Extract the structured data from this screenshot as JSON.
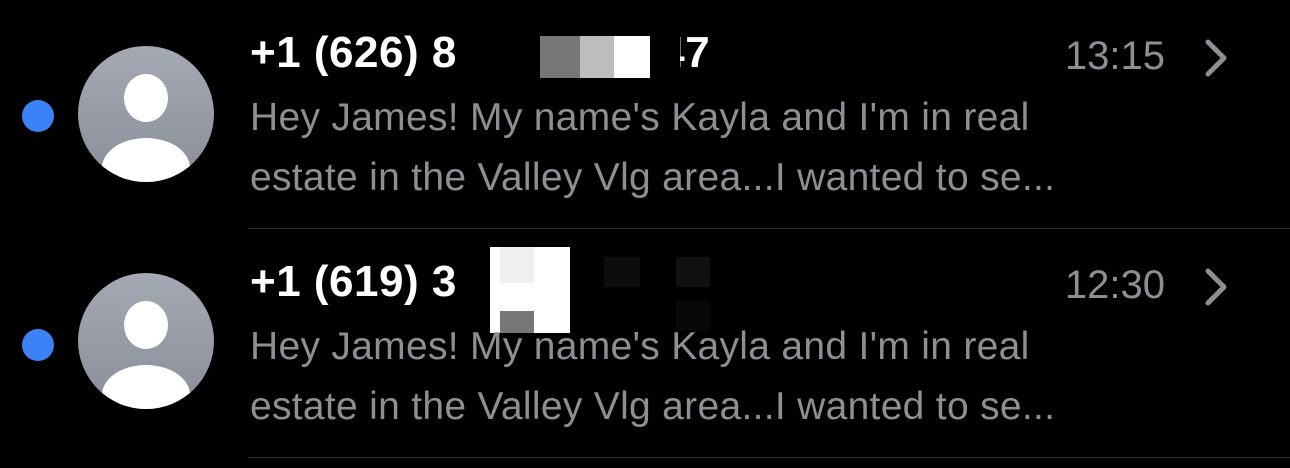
{
  "colors": {
    "background": "#000000",
    "unread_dot": "#3b82f6",
    "sender_text": "#ffffff",
    "secondary_text": "#8e8e93",
    "separator": "#2c2c2e"
  },
  "conversations": [
    {
      "sender_prefix": "+1 (626) 8",
      "sender_suffix": "47",
      "time": "13:15",
      "unread": true,
      "avatar_icon": "person-placeholder-icon",
      "chevron_icon": "chevron-right-icon",
      "preview_line_1": "Hey James! My name's Kayla and I'm in real",
      "preview_line_2": "estate in the Valley Vlg area...I wanted to se..."
    },
    {
      "sender_prefix": "+1 (619) 3",
      "sender_suffix": "",
      "time": "12:30",
      "unread": true,
      "avatar_icon": "person-placeholder-icon",
      "chevron_icon": "chevron-right-icon",
      "preview_line_1": "Hey James! My name's Kayla and I'm in real",
      "preview_line_2": "estate in the Valley Vlg area...I wanted to se..."
    }
  ]
}
